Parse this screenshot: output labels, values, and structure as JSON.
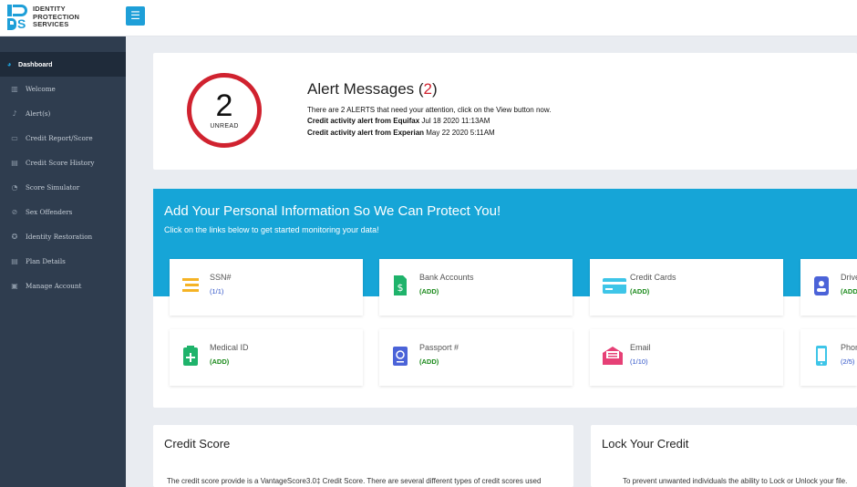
{
  "logo": {
    "line1": "IDENTITY",
    "line2": "PROTECTION",
    "line3": "SERVICES",
    "mark_s": "S"
  },
  "header": {
    "menu_icon": "☰"
  },
  "sidebar": {
    "items": [
      {
        "label": "Dashboard",
        "icon": "dashboard-icon"
      },
      {
        "label": "Welcome",
        "icon": "welcome-icon"
      },
      {
        "label": "Alert(s)",
        "icon": "bell-icon"
      },
      {
        "label": "Credit Report/Score",
        "icon": "credit-card-icon"
      },
      {
        "label": "Credit Score History",
        "icon": "history-icon"
      },
      {
        "label": "Score Simulator",
        "icon": "simulator-icon"
      },
      {
        "label": "Sex Offenders",
        "icon": "ban-icon"
      },
      {
        "label": "Identity Restoration",
        "icon": "restoration-icon"
      },
      {
        "label": "Plan Details",
        "icon": "plan-icon"
      },
      {
        "label": "Manage Account",
        "icon": "account-icon"
      }
    ]
  },
  "alerts": {
    "unread_count": "2",
    "unread_label": "UNREAD",
    "title": "Alert Messages (",
    "title_count": "2",
    "title_end": ")",
    "summary": "There are 2 ALERTS that need your attention, click on the View button now.",
    "items": [
      {
        "bold": "Credit activity alert from Equifax",
        "date": " Jul 18 2020 11:13AM"
      },
      {
        "bold": "Credit activity alert from Experian",
        "date": " May 22 2020 5:11AM"
      }
    ]
  },
  "personal_info": {
    "title": "Add Your Personal Information So We Can Protect You!",
    "subtitle": "Click on the links below to get started monitoring your data!",
    "tiles": [
      {
        "label": "SSN#",
        "value": "(1/1)",
        "icon": "ssn-icon",
        "color": "#f5b325"
      },
      {
        "label": "Bank Accounts",
        "value": "(ADD)",
        "icon": "bank-doc-icon",
        "color": "#1fb36b"
      },
      {
        "label": "Credit Cards",
        "value": "(ADD)",
        "icon": "credit-card-icon",
        "color": "#3ec5e8"
      },
      {
        "label": "Drive",
        "value": "(ADD",
        "icon": "drivers-license-icon",
        "color": "#4b63d8"
      },
      {
        "label": "Medical ID",
        "value": "(ADD)",
        "icon": "medical-id-icon",
        "color": "#1fb36b"
      },
      {
        "label": "Passport #",
        "value": "(ADD)",
        "icon": "passport-icon",
        "color": "#4b63d8"
      },
      {
        "label": "Email",
        "value": "(1/10)",
        "icon": "email-icon",
        "color": "#e64076"
      },
      {
        "label": "Phon",
        "value": "(2/5)",
        "icon": "phone-icon",
        "color": "#3ec5e8"
      }
    ]
  },
  "credit_score": {
    "title": "Credit Score",
    "text": "The credit score provide is a VantageScore3.0‡ Credit Score. There are several different types of credit scores used"
  },
  "lock_credit": {
    "title": "Lock Your Credit",
    "text": "To prevent unwanted individuals the ability to Lock or Unlock your file."
  }
}
